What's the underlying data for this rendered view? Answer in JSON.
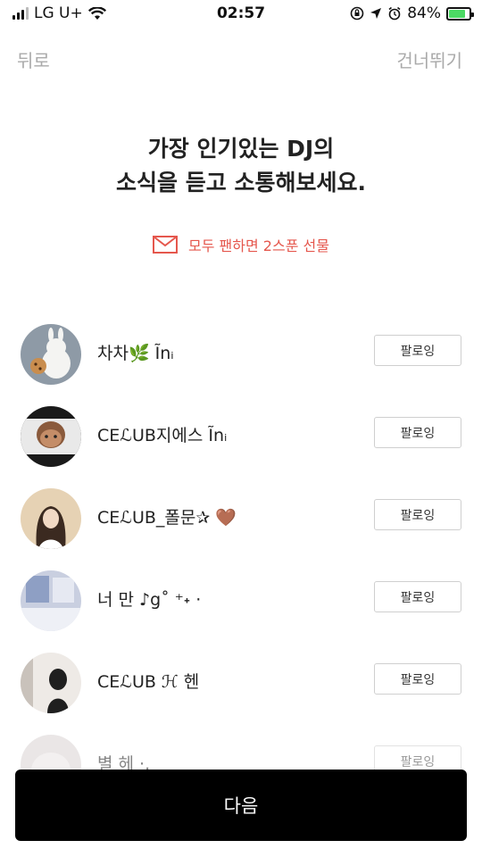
{
  "status_bar": {
    "carrier": "LG U+",
    "time": "02:57",
    "battery": "84%",
    "battery_level": 0.84
  },
  "nav": {
    "back_label": "뒤로",
    "skip_label": "건너뛰기"
  },
  "headline": {
    "line1": "가장 인기있는 DJ의",
    "line2": "소식을 듣고 소통해보세요."
  },
  "promo": {
    "text": "모두 팬하면 2스푼 선물",
    "icon": "envelope-icon",
    "color": "#e5574d"
  },
  "djs": [
    {
      "name": "차차🌿   Ĩnᵢ",
      "follow_label": "팔로잉"
    },
    {
      "name": "CEℒUB지에스  Ĩnᵢ",
      "follow_label": "팔로잉"
    },
    {
      "name": "CEℒUB_폴문✰     🤎",
      "follow_label": "팔로잉"
    },
    {
      "name": "너 만 ♪ց˚ ⁺˖ ·",
      "follow_label": "팔로잉"
    },
    {
      "name": "CEℒUB       ℋ 헨",
      "follow_label": "팔로잉"
    },
    {
      "name": "별 헤 ·.",
      "follow_label": "팔로잉"
    }
  ],
  "next_button": {
    "label": "다음"
  }
}
